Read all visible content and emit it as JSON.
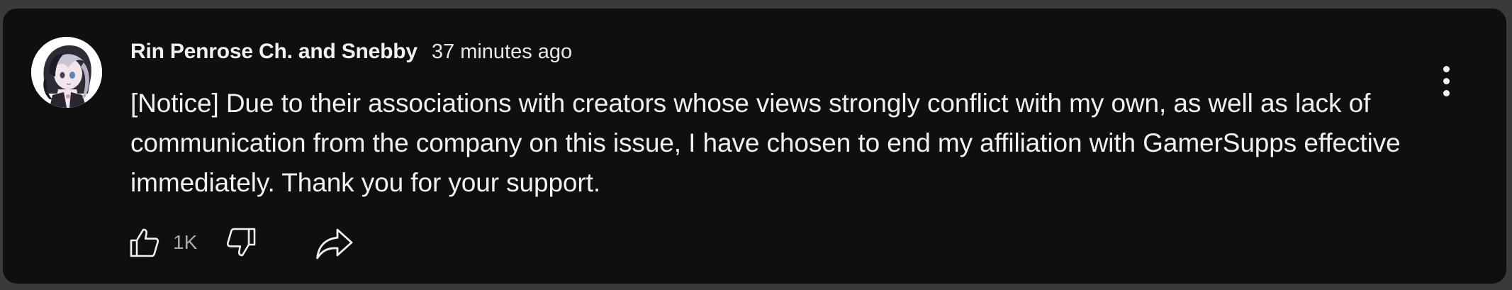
{
  "comment": {
    "author": "Rin Penrose Ch. and Snebby",
    "timestamp": "37 minutes ago",
    "text": "[Notice] Due to their associations with creators whose views strongly conflict with my own, as well as lack of communication from the company on this issue, I have chosen to end my affiliation with GamerSupps effective immediately. Thank you for your support.",
    "like_count": "1K"
  },
  "icons": {
    "avatar": "avatar-image",
    "like": "thumbs-up-icon",
    "dislike": "thumbs-down-icon",
    "share": "share-arrow-icon",
    "more": "vertical-ellipsis-icon"
  },
  "colors": {
    "background": "#0f0f0f",
    "text_primary": "#f1f1f1",
    "text_secondary": "#aaaaaa",
    "border": "#3b3b3b"
  }
}
